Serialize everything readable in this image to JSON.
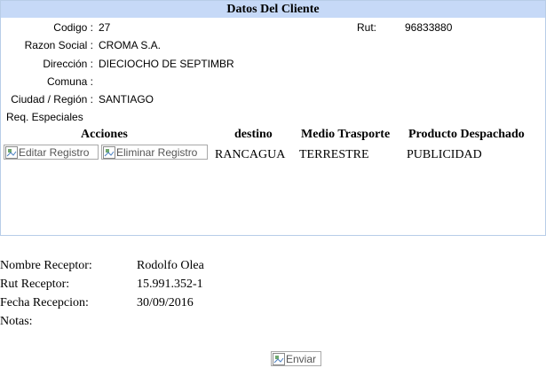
{
  "panel": {
    "title": "Datos Del Cliente",
    "fields": [
      {
        "label": "Codigo :",
        "value": "27"
      },
      {
        "label": "Razon Social :",
        "value": "CROMA S.A."
      },
      {
        "label": "Dirección :",
        "value": "DIECIOCHO DE SEPTIMBR"
      },
      {
        "label": "Comuna :",
        "value": ""
      },
      {
        "label": "Ciudad / Región :",
        "value": "SANTIAGO"
      },
      {
        "label": "Req. Especiales",
        "value": ""
      }
    ],
    "rut_label": "Rut:",
    "rut_value": "96833880"
  },
  "table": {
    "headers": [
      "Acciones",
      "destino",
      "Medio Trasporte",
      "Producto Despachado"
    ],
    "rows": [
      {
        "edit_label": "Editar Registro",
        "delete_label": "Eliminar Registro",
        "destino": "RANCAGUA",
        "medio": "TERRESTRE",
        "producto": "PUBLICIDAD"
      }
    ]
  },
  "receptor": {
    "nombre_label": "Nombre Receptor:",
    "nombre_value": "Rodolfo Olea",
    "rut_label": "Rut Receptor:",
    "rut_value": "15.991.352-1",
    "fecha_label": "Fecha Recepcion:",
    "fecha_value": "30/09/2016",
    "notas_label": "Notas:"
  },
  "submit": {
    "label": "Enviar"
  },
  "icons": {
    "broken_image": "broken-image-icon"
  }
}
